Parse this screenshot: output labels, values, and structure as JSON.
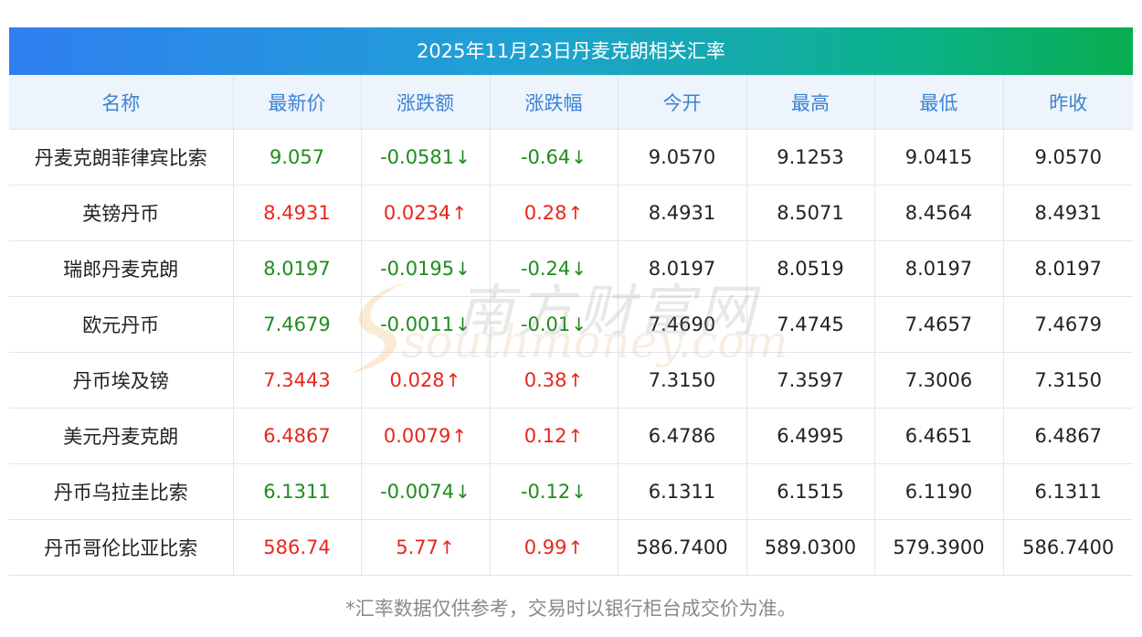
{
  "title": "2025年11月23日丹麦克朗相关汇率",
  "columns": [
    "名称",
    "最新价",
    "涨跌额",
    "涨跌幅",
    "今开",
    "最高",
    "最低",
    "昨收"
  ],
  "rows": [
    {
      "name": "丹麦克朗菲律宾比索",
      "latest": "9.057",
      "change": "-0.0581",
      "pct": "-0.64",
      "dir": "down",
      "arrow": "↓",
      "open": "9.0570",
      "high": "9.1253",
      "low": "9.0415",
      "prev": "9.0570"
    },
    {
      "name": "英镑丹币",
      "latest": "8.4931",
      "change": "0.0234",
      "pct": "0.28",
      "dir": "up",
      "arrow": "↑",
      "open": "8.4931",
      "high": "8.5071",
      "low": "8.4564",
      "prev": "8.4931"
    },
    {
      "name": "瑞郎丹麦克朗",
      "latest": "8.0197",
      "change": "-0.0195",
      "pct": "-0.24",
      "dir": "down",
      "arrow": "↓",
      "open": "8.0197",
      "high": "8.0519",
      "low": "8.0197",
      "prev": "8.0197"
    },
    {
      "name": "欧元丹币",
      "latest": "7.4679",
      "change": "-0.0011",
      "pct": "-0.01",
      "dir": "down",
      "arrow": "↓",
      "open": "7.4690",
      "high": "7.4745",
      "low": "7.4657",
      "prev": "7.4679"
    },
    {
      "name": "丹币埃及镑",
      "latest": "7.3443",
      "change": "0.028",
      "pct": "0.38",
      "dir": "up",
      "arrow": "↑",
      "open": "7.3150",
      "high": "7.3597",
      "low": "7.3006",
      "prev": "7.3150"
    },
    {
      "name": "美元丹麦克朗",
      "latest": "6.4867",
      "change": "0.0079",
      "pct": "0.12",
      "dir": "up",
      "arrow": "↑",
      "open": "6.4786",
      "high": "6.4995",
      "low": "6.4651",
      "prev": "6.4867"
    },
    {
      "name": "丹币乌拉圭比索",
      "latest": "6.1311",
      "change": "-0.0074",
      "pct": "-0.12",
      "dir": "down",
      "arrow": "↓",
      "open": "6.1311",
      "high": "6.1515",
      "low": "6.1190",
      "prev": "6.1311"
    },
    {
      "name": "丹币哥伦比亚比索",
      "latest": "586.74",
      "change": "5.77",
      "pct": "0.99",
      "dir": "up",
      "arrow": "↑",
      "open": "586.7400",
      "high": "589.0300",
      "low": "579.3900",
      "prev": "586.7400"
    }
  ],
  "note": "*汇率数据仅供参考，交易时以银行柜台成交价为准。",
  "watermark": {
    "cn": "南方财富网",
    "en": "southmoney.com"
  },
  "colors": {
    "up": "#e8261c",
    "down": "#1e8c1e",
    "header_text": "#3b83d4",
    "header_bg": "#eef4fc"
  }
}
